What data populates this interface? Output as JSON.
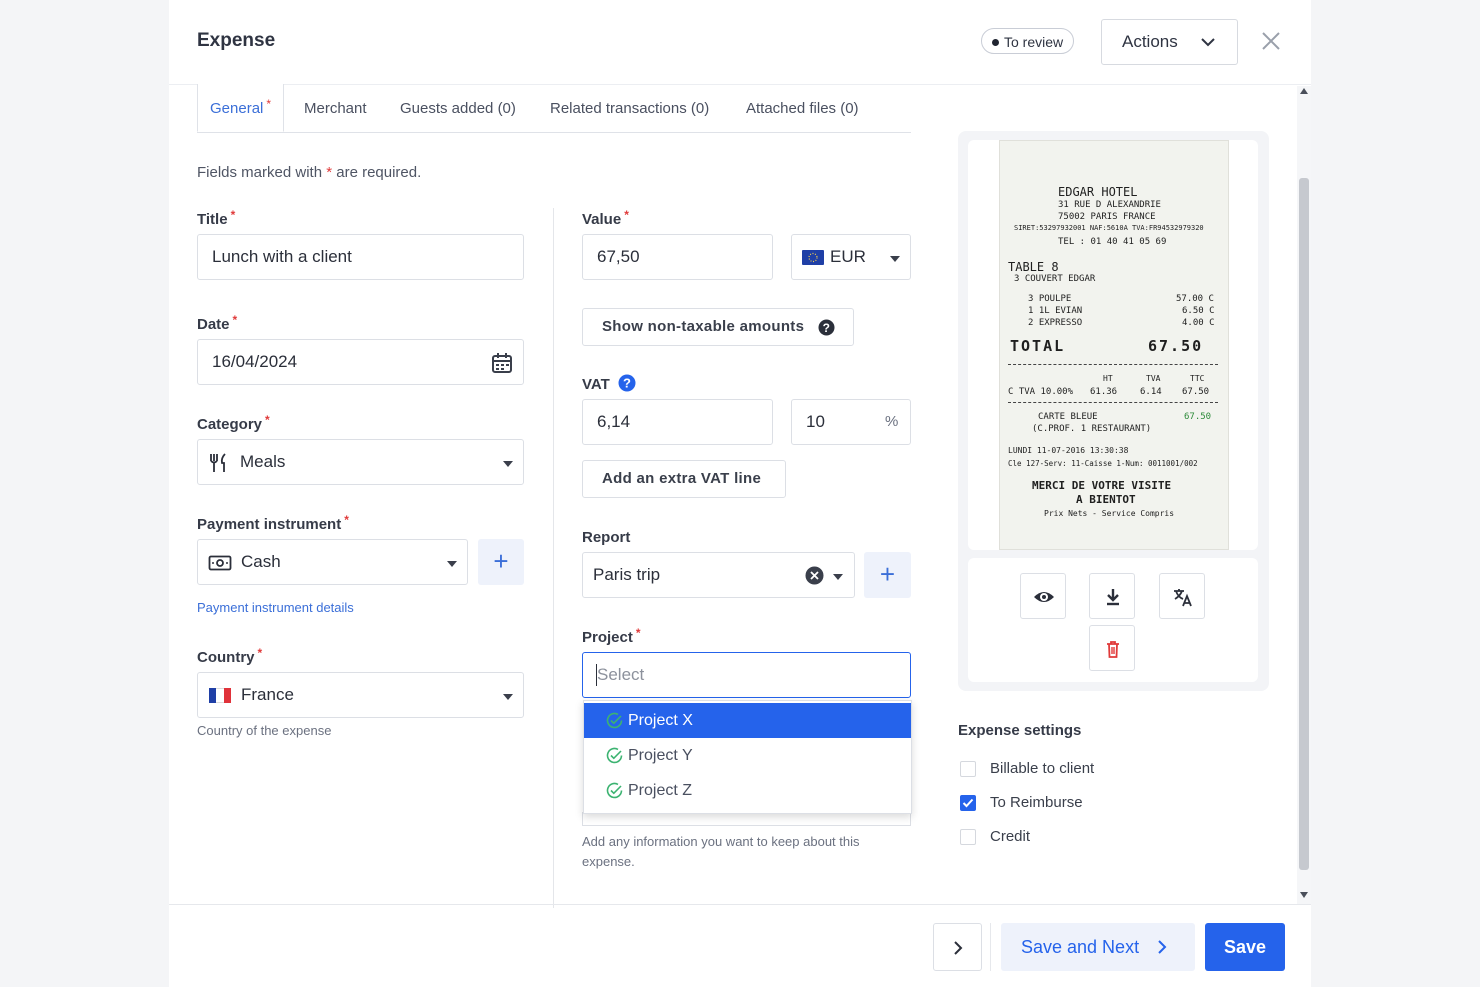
{
  "header": {
    "title": "Expense",
    "status": "To review",
    "actions_label": "Actions"
  },
  "tabs": [
    {
      "label": "General",
      "active": true,
      "required": true
    },
    {
      "label": "Merchant"
    },
    {
      "label": "Guests added (0)"
    },
    {
      "label": "Related transactions (0)"
    },
    {
      "label": "Attached files (0)"
    }
  ],
  "form": {
    "required_note_prefix": "Fields marked with",
    "required_note_suffix": "are required.",
    "required_mark": "*",
    "title": {
      "label": "Title",
      "value": "Lunch with a client"
    },
    "date": {
      "label": "Date",
      "value": "16/04/2024"
    },
    "category": {
      "label": "Category",
      "value": "Meals"
    },
    "payment": {
      "label": "Payment instrument",
      "value": "Cash",
      "details_link": "Payment instrument details"
    },
    "country": {
      "label": "Country",
      "value": "France",
      "help": "Country of the expense"
    },
    "value": {
      "label": "Value",
      "amount": "67,50",
      "currency": "EUR"
    },
    "non_taxable_button": "Show non-taxable amounts",
    "vat": {
      "label": "VAT",
      "amount": "6,14",
      "rate": "10",
      "unit": "%"
    },
    "extra_vat_button": "Add an extra VAT line",
    "report": {
      "label": "Report",
      "value": "Paris trip"
    },
    "project": {
      "label": "Project",
      "placeholder": "Select",
      "options": [
        "Project X",
        "Project Y",
        "Project Z"
      ],
      "highlighted_index": 0
    },
    "notes_help": "Add any information you want to keep about this expense."
  },
  "receipt": {
    "hotel": "EDGAR HOTEL",
    "address1": "31 RUE D ALEXANDRIE",
    "address2": "75002 PARIS FRANCE",
    "siret": "SIRET:53297932001 NAF:5610A TVA:FR94532979320",
    "tel": "TEL : 01 40 41 05 69",
    "table": "TABLE    8",
    "couvert": "3 COUVERT   EDGAR",
    "item1": "3 POULPE",
    "price1": "57.00 C",
    "item2": "1 1L EVIAN",
    "price2": "6.50 C",
    "item3": "2 EXPRESSO",
    "price3": "4.00 C",
    "total_label": "TOTAL",
    "total_value": "67.50",
    "vat_ht_head": "HT",
    "vat_tva_head": "TVA",
    "vat_ttc_head": "TTC",
    "vat_row_label": "C TVA 10.00%",
    "vat_ht": "61.36",
    "vat_tva": "6.14",
    "vat_ttc": "67.50",
    "card1": "CARTE BLEUE",
    "card2": "(C.PROF. 1 RESTAURANT)",
    "card_amount": "67.50",
    "date_line": "LUNDI 11-07-2016 13:30:38",
    "cashier_line": "Cle 127-Serv: 11-Caisse  1-Num: 0011001/002",
    "thanks1": "MERCI DE VOTRE VISITE",
    "thanks2": "A BIENTOT",
    "footer": "Prix Nets - Service Compris"
  },
  "preview_actions": [
    "eye-icon",
    "download-icon",
    "translate-icon",
    "trash-icon"
  ],
  "settings": {
    "title": "Expense settings",
    "items": [
      {
        "label": "Billable to client",
        "checked": false
      },
      {
        "label": "To Reimburse",
        "checked": true
      },
      {
        "label": "Credit",
        "checked": false
      }
    ]
  },
  "footer": {
    "save_next_label": "Save and Next",
    "save_label": "Save"
  },
  "colors": {
    "accent": "#2563eb",
    "required": "#e03a3a",
    "link": "#3b6fd8"
  }
}
